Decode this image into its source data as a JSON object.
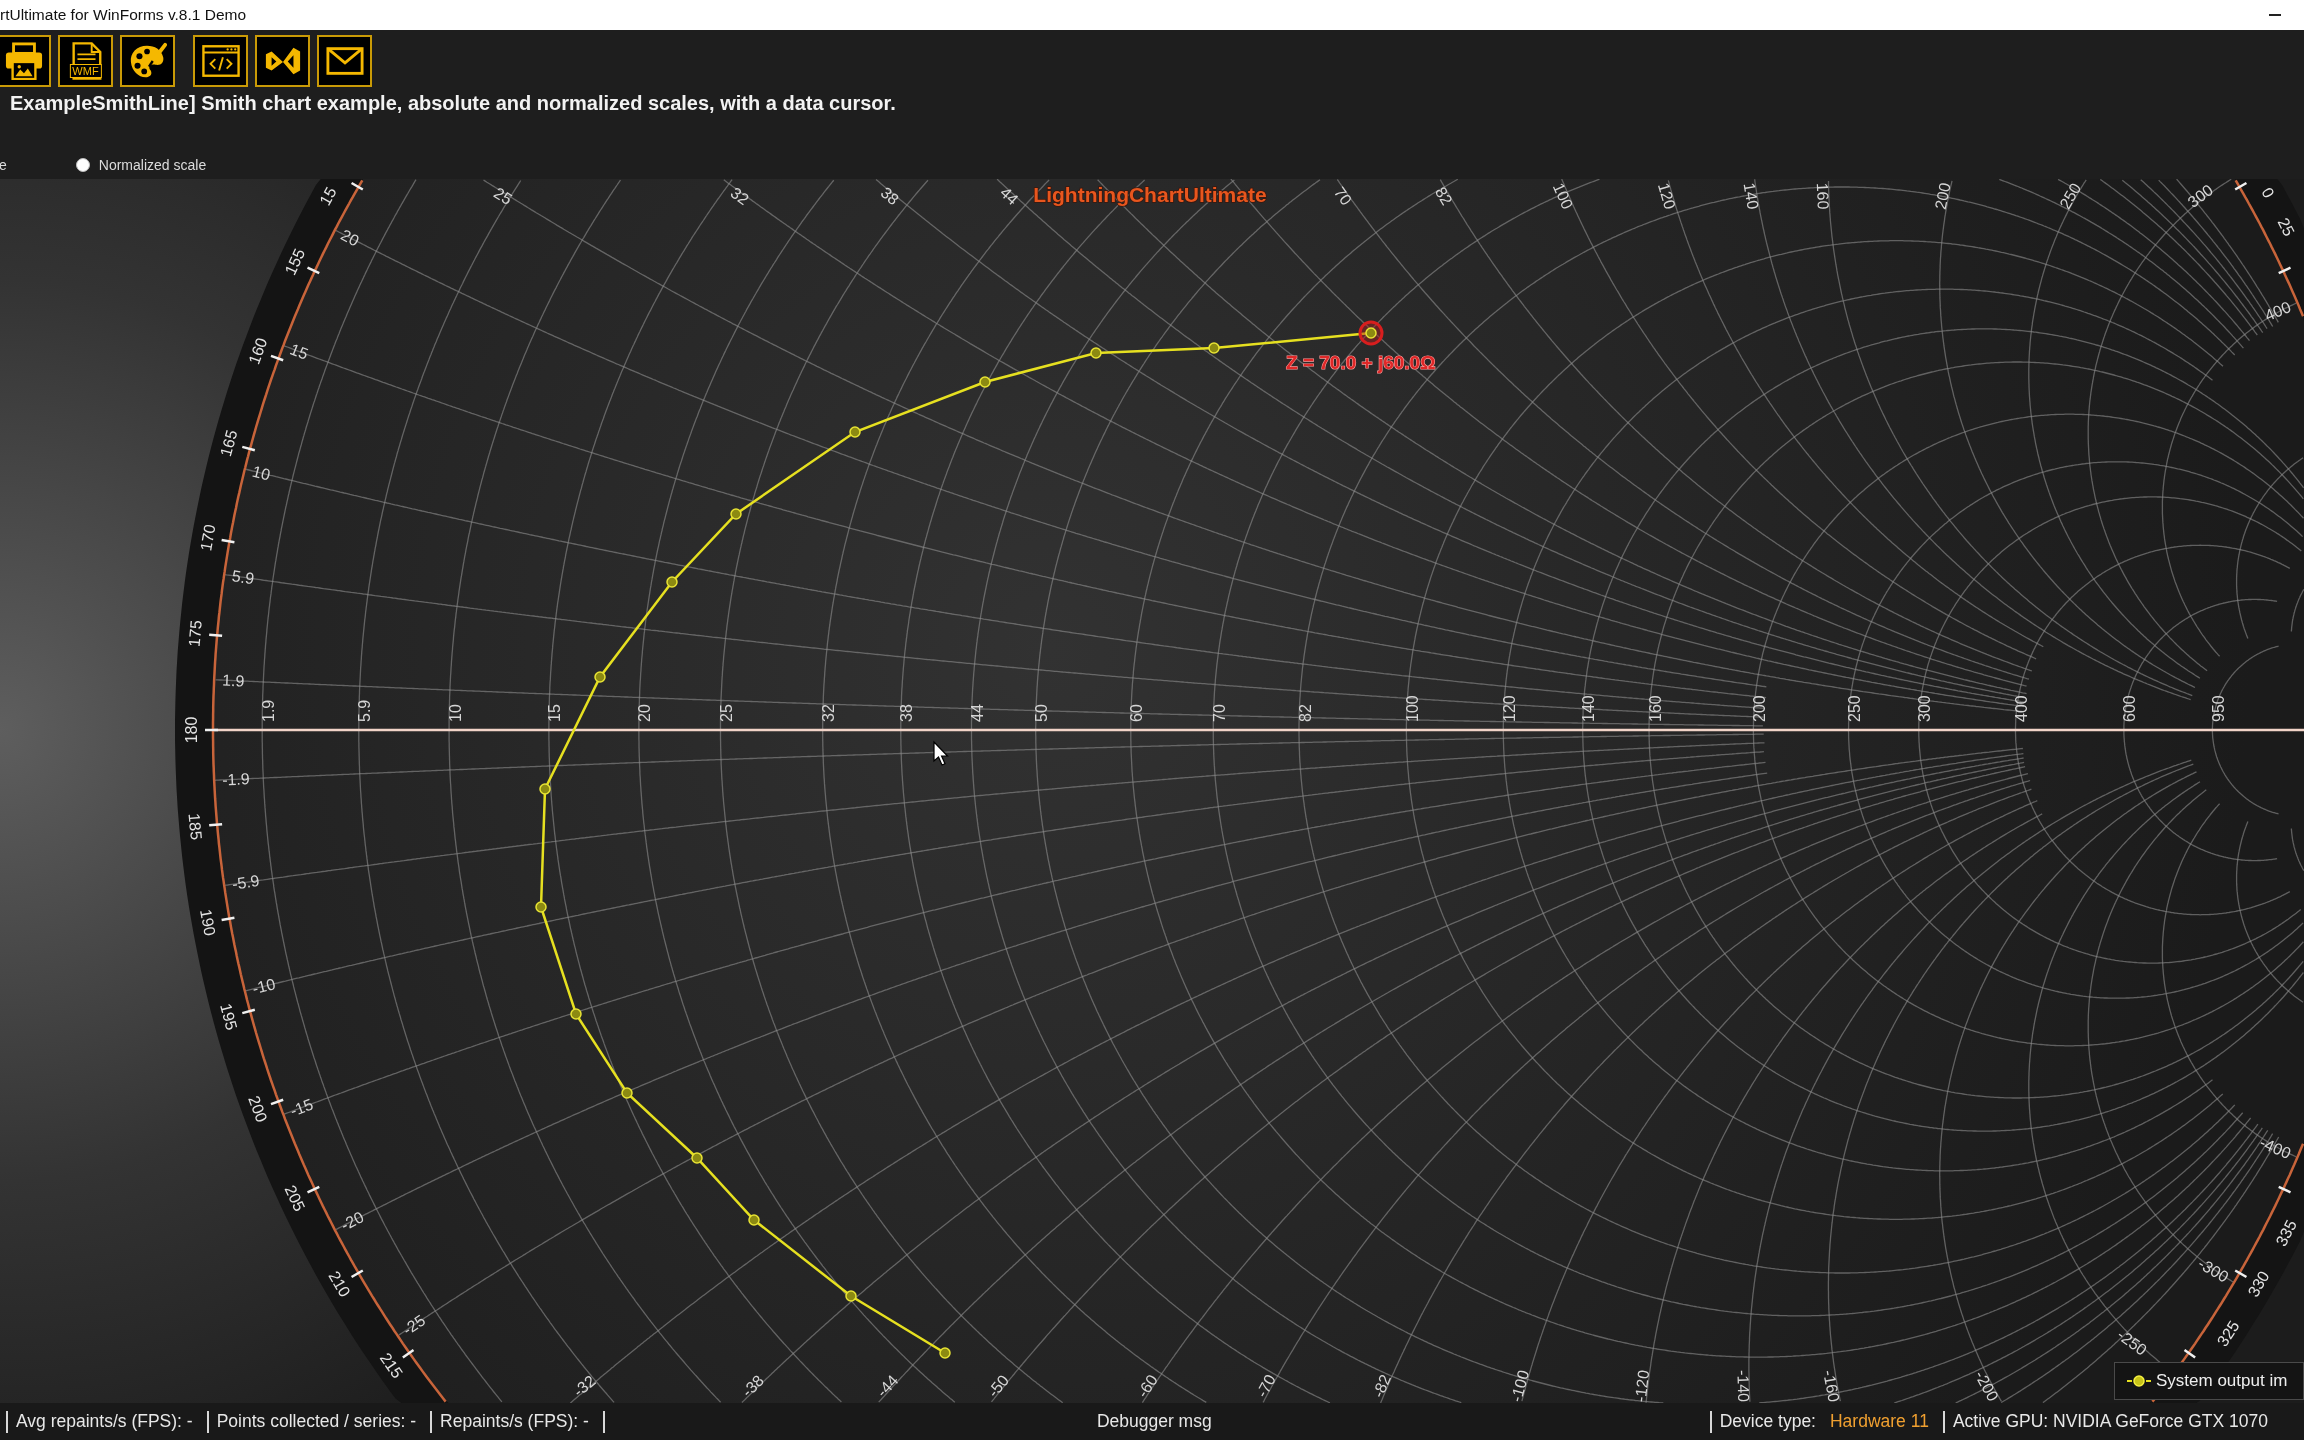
{
  "window": {
    "title": "rtUltimate for WinForms v.8.1 Demo"
  },
  "toolbar": [
    {
      "kind": "print"
    },
    {
      "kind": "wmf",
      "label": "WMF"
    },
    {
      "kind": "palette"
    },
    {
      "kind": "code"
    },
    {
      "kind": "bowtie"
    },
    {
      "kind": "mail"
    }
  ],
  "description": "ExampleSmithLine] Smith chart example, absolute and normalized scales, with a data cursor.",
  "scale_selector": {
    "cut_label": "e",
    "option": {
      "label": "Normalized scale",
      "selected": false
    }
  },
  "chart": {
    "title": "LightningChartUltimate",
    "angle_labels": [
      "15",
      "155",
      "160",
      "165",
      "170",
      "175",
      "180",
      "185",
      "190",
      "195",
      "200",
      "205",
      "210",
      "215",
      "0",
      "25",
      "335",
      "330",
      "325"
    ],
    "axis_labels": [
      "1.9",
      "5.9",
      "10",
      "15",
      "20",
      "25",
      "32",
      "38",
      "44",
      "50",
      "60",
      "70",
      "82",
      "100",
      "120",
      "140",
      "160",
      "200",
      "250",
      "300",
      "400",
      "600",
      "950"
    ],
    "reactance_labels": [
      "25",
      "32",
      "38",
      "44",
      "70",
      "82",
      "100",
      "120",
      "140",
      "160",
      "200",
      "250",
      "300",
      "400",
      "20",
      "15",
      "10",
      "5.9",
      "1.9",
      "-1.9",
      "-5.9",
      "-10",
      "-15",
      "-20",
      "-25",
      "-32",
      "-38",
      "-44",
      "-50",
      "-60",
      "-70",
      "-82",
      "-100",
      "-120",
      "-140",
      "-160",
      "-200",
      "-250",
      "-300",
      "-400"
    ],
    "cursor": {
      "label": "Z = 70.0 + j60.0Ω"
    },
    "legend": {
      "label": "System output im"
    }
  },
  "status_bar": {
    "items": [
      "Avg repaints/s (FPS): -",
      "Points collected / series: -",
      "Repaints/s (FPS): -"
    ],
    "message": "Debugger msg",
    "device_type": {
      "label": "Device type:",
      "value": "Hardware 11"
    },
    "gpu": "Active GPU: NVIDIA GeForce GTX 1070"
  }
}
